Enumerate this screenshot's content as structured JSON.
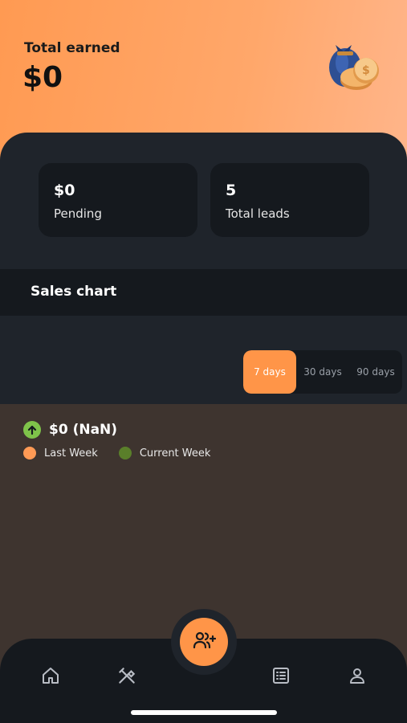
{
  "header": {
    "total_earned_label": "Total earned",
    "total_earned_value": "$0",
    "icon": "money-bag-icon"
  },
  "stats": {
    "pending_value": "$0",
    "pending_label": "Pending",
    "leads_value": "5",
    "leads_label": "Total leads"
  },
  "sales_chart": {
    "title": "Sales chart",
    "ranges": [
      "7 days",
      "30 days",
      "90 days"
    ],
    "selected_range": "7 days",
    "trend_value": "$0 (NaN)",
    "trend_icon": "arrow-up-icon",
    "legend": [
      {
        "label": "Last Week",
        "color": "#ff9a55"
      },
      {
        "label": "Current Week",
        "color": "#5a7f2a"
      }
    ]
  },
  "nav": {
    "items": [
      "home-icon",
      "tools-icon",
      "add-user-icon",
      "list-icon",
      "profile-icon"
    ]
  },
  "colors": {
    "accent": "#ff9548",
    "trend_up": "#7fc34a",
    "panel": "#1f242b",
    "card": "#15191e"
  }
}
